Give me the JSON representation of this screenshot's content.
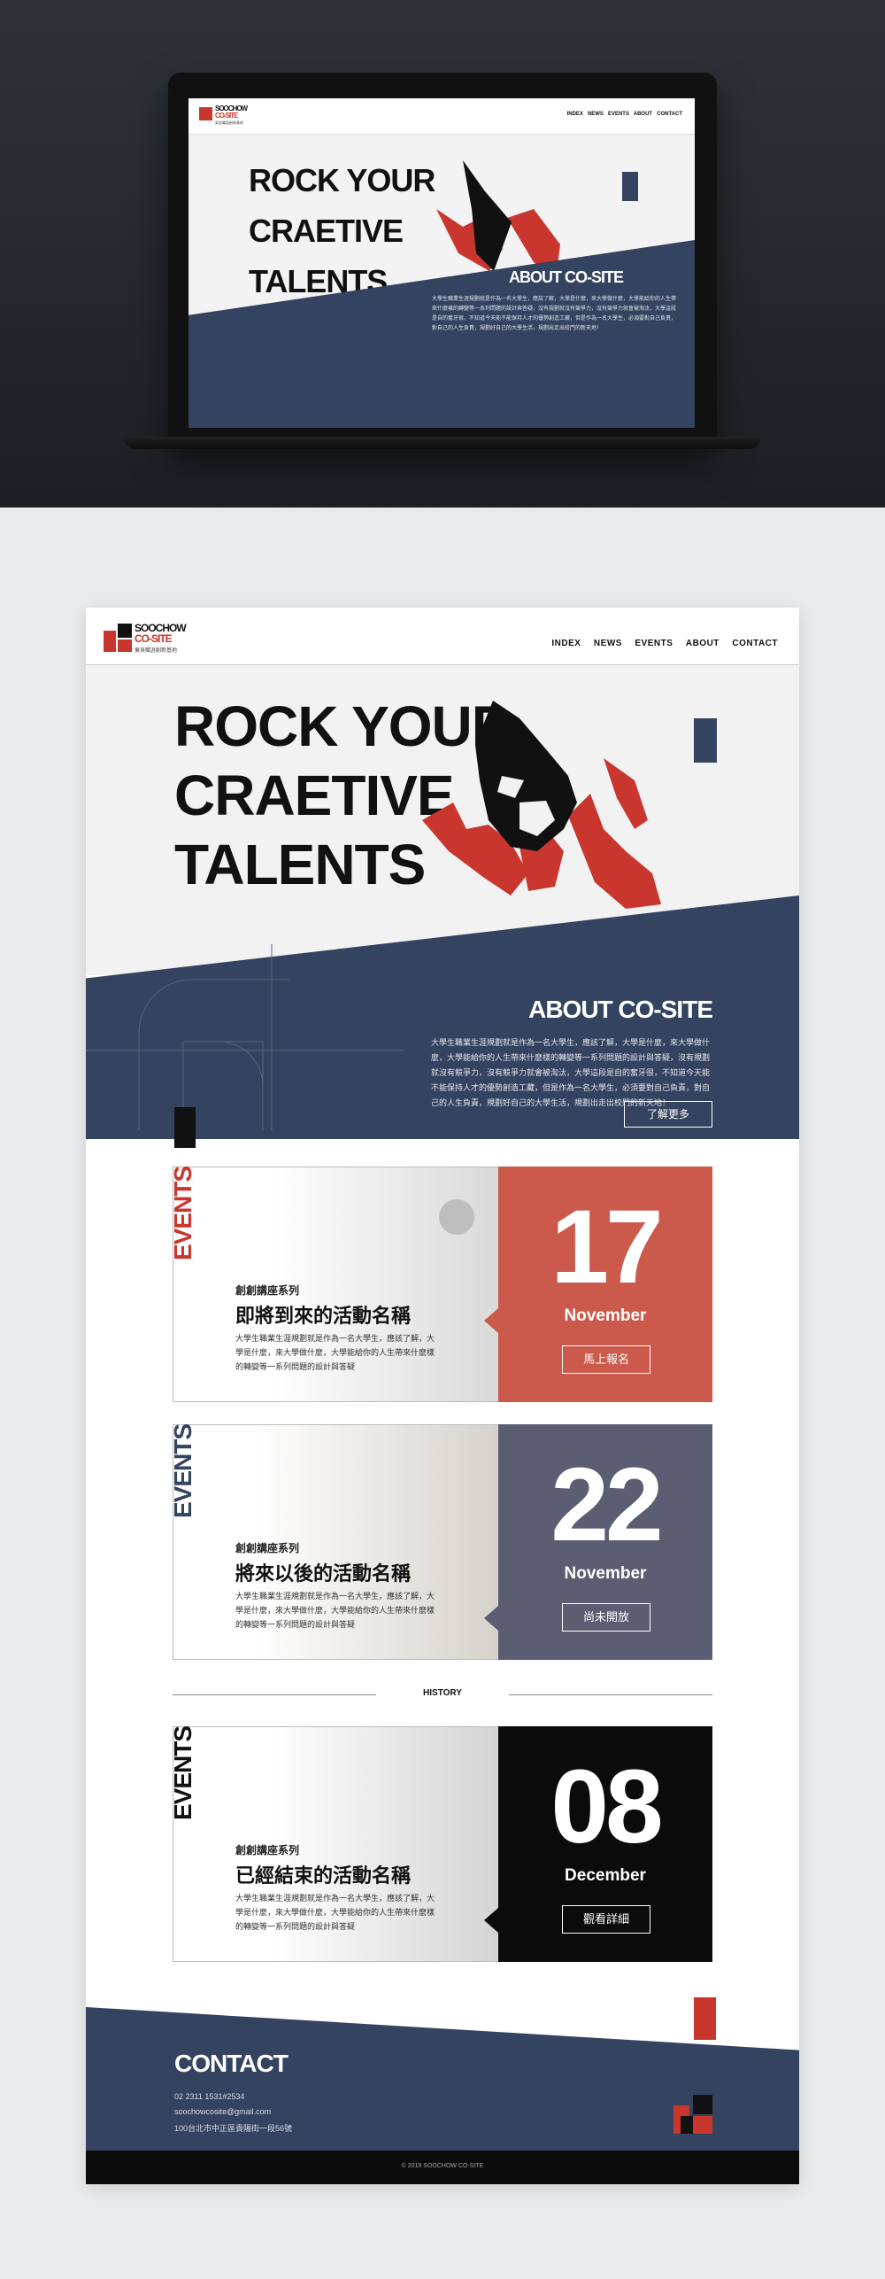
{
  "brand": {
    "line1": "SOOCHOW",
    "line2": "CO-SITE",
    "sub": "東吳職涯創新基地"
  },
  "nav": [
    "INDEX",
    "NEWS",
    "EVENTS",
    "ABOUT",
    "CONTACT"
  ],
  "hero": {
    "line1": "ROCK YOUR",
    "line2": "CRAETIVE",
    "line3": "TALENTS"
  },
  "about": {
    "title": "ABOUT CO-SITE",
    "text": "大學生職業生涯規劃就是作為一名大學生，應該了解，大學是什麼，來大學做什麼，大學能給你的人生帶來什麼樣的轉變等一系列問題的設計與答疑，沒有規劃就沒有競爭力，沒有競爭力就會被淘汰，大學這段是自的奮牙很，不知道今天能不能保持人才的優勢創造工藏，但是作為一名大學生，必須要對自己負責，對自己的人生負責，規劃好自己的大學生活，規劃出走出校門的新天地！",
    "button": "了解更多"
  },
  "events_label": "EVENTS",
  "events": [
    {
      "series": "創創講座系列",
      "title": "即將到來的活動名稱",
      "desc": "大學生職業生涯規劃就是作為一名大學生，應該了解，大學是什麼，來大學做什麼，大學能給你的人生帶來什麼樣的轉變等一系列問題的設計與答疑",
      "day": "17",
      "month": "November",
      "button": "馬上報名",
      "color": "#cc5a4c"
    },
    {
      "series": "創創講座系列",
      "title": "將來以後的活動名稱",
      "desc": "大學生職業生涯規劃就是作為一名大學生，應該了解，大學是什麼，來大學做什麼，大學能給你的人生帶來什麼樣的轉變等一系列問題的設計與答疑",
      "day": "22",
      "month": "November",
      "button": "尚未開放",
      "color": "#5b5e73"
    },
    {
      "series": "創創講座系列",
      "title": "已經結束的活動名稱",
      "desc": "大學生職業生涯規劃就是作為一名大學生，應該了解，大學是什麼，來大學做什麼，大學能給你的人生帶來什麼樣的轉變等一系列問題的設計與答疑",
      "day": "08",
      "month": "December",
      "button": "觀看詳細",
      "color": "#0b0b0b"
    }
  ],
  "history_label": "HISTORY",
  "contact": {
    "title": "CONTACT",
    "phone": "02 2311 1531#2534",
    "email": "soochowcosite@gmail.com",
    "address": "100台北市中正區貴陽街一段56號"
  },
  "footer": "© 2018 SOOCHOW CO-SITE",
  "colors": {
    "navy": "#34435f",
    "red": "#c8362e",
    "coral": "#cc5a4c",
    "slate": "#5b5e73",
    "black": "#0b0b0b"
  }
}
